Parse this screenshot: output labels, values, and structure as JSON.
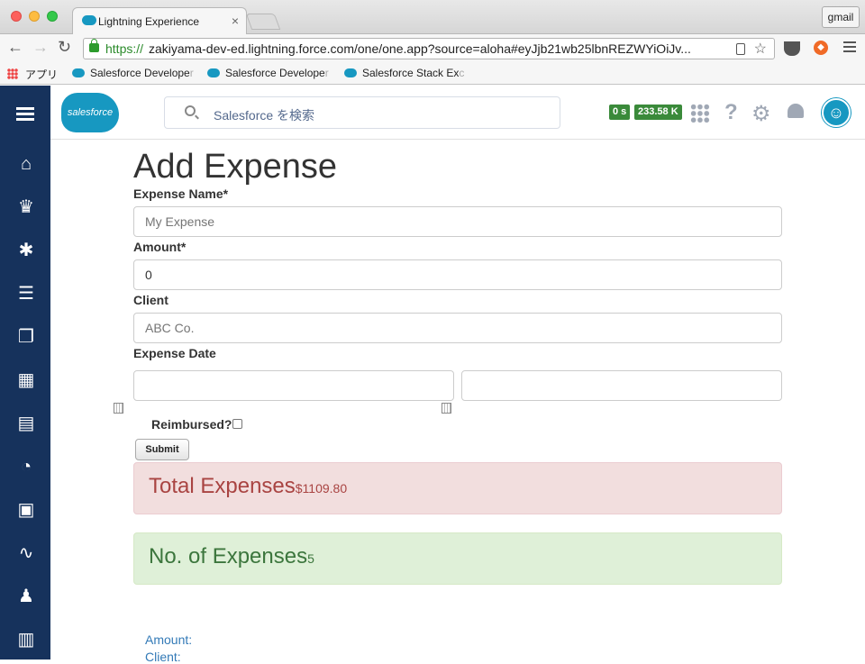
{
  "browser": {
    "tab_title": "Lightning Experience",
    "tab_close": "×",
    "profile_button": "gmail",
    "url_scheme": "https://",
    "url_rest": "zakiyama-dev-ed.lightning.force.com/one/one.app?source=aloha#eyJjb21wb25lbnREZWYiOiJv...",
    "bookmarks": [
      {
        "label": "アプリ"
      },
      {
        "label": "Salesforce Develope",
        "fade": "r"
      },
      {
        "label": "Salesforce Develope",
        "fade": "r"
      },
      {
        "label": "Salesforce Stack Ex",
        "fade": "c"
      }
    ]
  },
  "header": {
    "logo_text": "salesforce",
    "search_placeholder": "Salesforce を検索",
    "badge_time": "0 s",
    "badge_size": "233.58 K"
  },
  "form": {
    "title": "Add Expense",
    "name_label": "Expense Name*",
    "name_placeholder": "My Expense",
    "amount_label": "Amount*",
    "amount_value": "0",
    "client_label": "Client",
    "client_placeholder": "ABC Co.",
    "date_label": "Expense Date",
    "reimbursed_label": "Reimbursed?",
    "submit_label": "Submit"
  },
  "summary": {
    "total_title": "Total Expenses",
    "total_value": "$1109.80",
    "count_title": "No. of Expenses",
    "count_value": "5"
  },
  "list": {
    "amount_label": "Amount:",
    "client_label": "Client:"
  },
  "colors": {
    "sidebar": "#16325c",
    "brand": "#1798c1",
    "danger_bg": "#f2dede",
    "success_bg": "#dff0d8"
  },
  "icons": {
    "sidebar": [
      "hamburger-icon",
      "home-icon",
      "crown-icon",
      "person-icon",
      "tasks-icon",
      "files-icon",
      "building-icon",
      "contact-card-icon",
      "gauge-icon",
      "clipboard-icon",
      "pulse-icon",
      "group-icon",
      "calendar-icon"
    ]
  }
}
